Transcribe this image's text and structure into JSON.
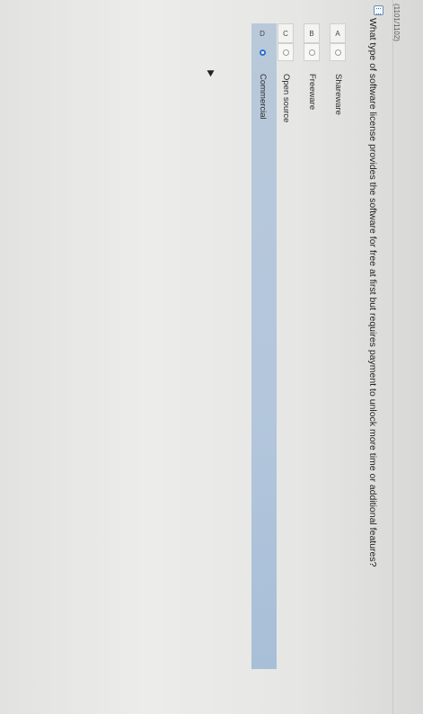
{
  "exam": {
    "id": "(1101/1102)"
  },
  "question": {
    "text": "What type of software license provides the software for free at first but requires payment to unlock more time or additional features?"
  },
  "options": [
    {
      "letter": "A",
      "label": "Shareware",
      "selected": false
    },
    {
      "letter": "B",
      "label": "Freeware",
      "selected": false
    },
    {
      "letter": "C",
      "label": "Open source",
      "selected": false
    },
    {
      "letter": "D",
      "label": "Commercial",
      "selected": true
    }
  ],
  "colors": {
    "selected_band": "#b3c6dc",
    "radio_selected": "#2c6fd6"
  },
  "icons": {
    "flag": "flag-icon",
    "cursor": "mouse-pointer-icon"
  }
}
